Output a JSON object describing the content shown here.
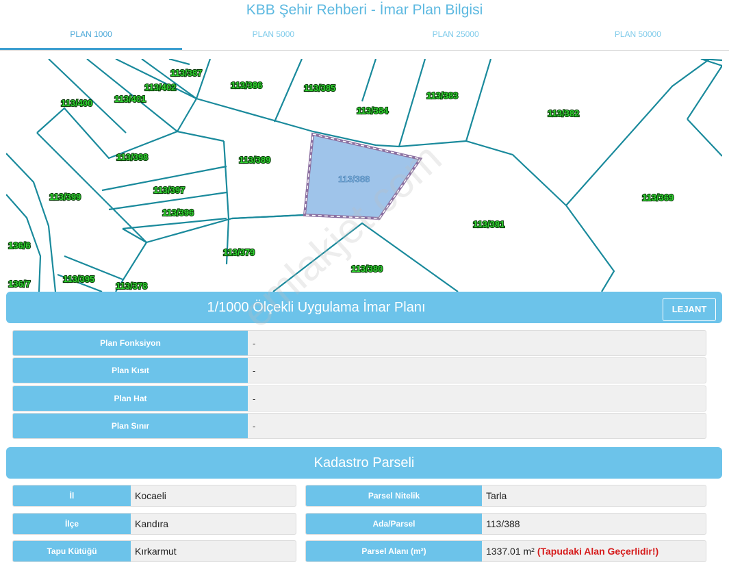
{
  "app": {
    "title": "KBB Şehir Rehberi - İmar Plan Bilgisi"
  },
  "tabs": [
    {
      "label": "PLAN 1000",
      "active": true
    },
    {
      "label": "PLAN 5000",
      "active": false
    },
    {
      "label": "PLAN 25000",
      "active": false
    },
    {
      "label": "PLAN 50000",
      "active": false
    }
  ],
  "map": {
    "parcels": [
      "113/387",
      "113/402",
      "113/386",
      "113/385",
      "113/400",
      "113/401",
      "113/384",
      "113/383",
      "113/382",
      "113/398",
      "113/389",
      "113/388",
      "113/397",
      "113/399",
      "113/396",
      "113/369",
      "113/381",
      "136/6",
      "113/379",
      "113/380",
      "136/7",
      "113/395",
      "113/378"
    ],
    "selected_parcel": "113/388",
    "colors": {
      "lines": "#1a8a9c",
      "selected_fill": "#9fc4ea",
      "selected_border": "#8b6fa0",
      "label": "#2fd12f"
    },
    "watermark": "emlakjet.com"
  },
  "plan": {
    "title": "1/1000 Ölçekli Uygulama İmar Planı",
    "lejant_label": "LEJANT",
    "rows": [
      {
        "label": "Plan Fonksiyon",
        "value": "-"
      },
      {
        "label": "Plan Kısıt",
        "value": "-"
      },
      {
        "label": "Plan Hat",
        "value": "-"
      },
      {
        "label": "Plan Sınır",
        "value": "-"
      }
    ]
  },
  "kadastro": {
    "title": "Kadastro Parseli",
    "left": [
      {
        "label": "İl",
        "value": "Kocaeli"
      },
      {
        "label": "İlçe",
        "value": "Kandıra"
      },
      {
        "label": "Tapu Kütüğü",
        "value": "Kırkarmut"
      }
    ],
    "right": [
      {
        "label": "Parsel Nitelik",
        "value": "Tarla"
      },
      {
        "label": "Ada/Parsel",
        "value": "113/388"
      },
      {
        "label": "Parsel Alanı (m²)",
        "value": "1337.01 m²",
        "note": "(Tapudaki Alan Geçerlidir!)"
      }
    ]
  },
  "theme": {
    "accent": "#6cc3ea",
    "tab_active": "#3d9fd0",
    "warning": "#d61c1c"
  }
}
